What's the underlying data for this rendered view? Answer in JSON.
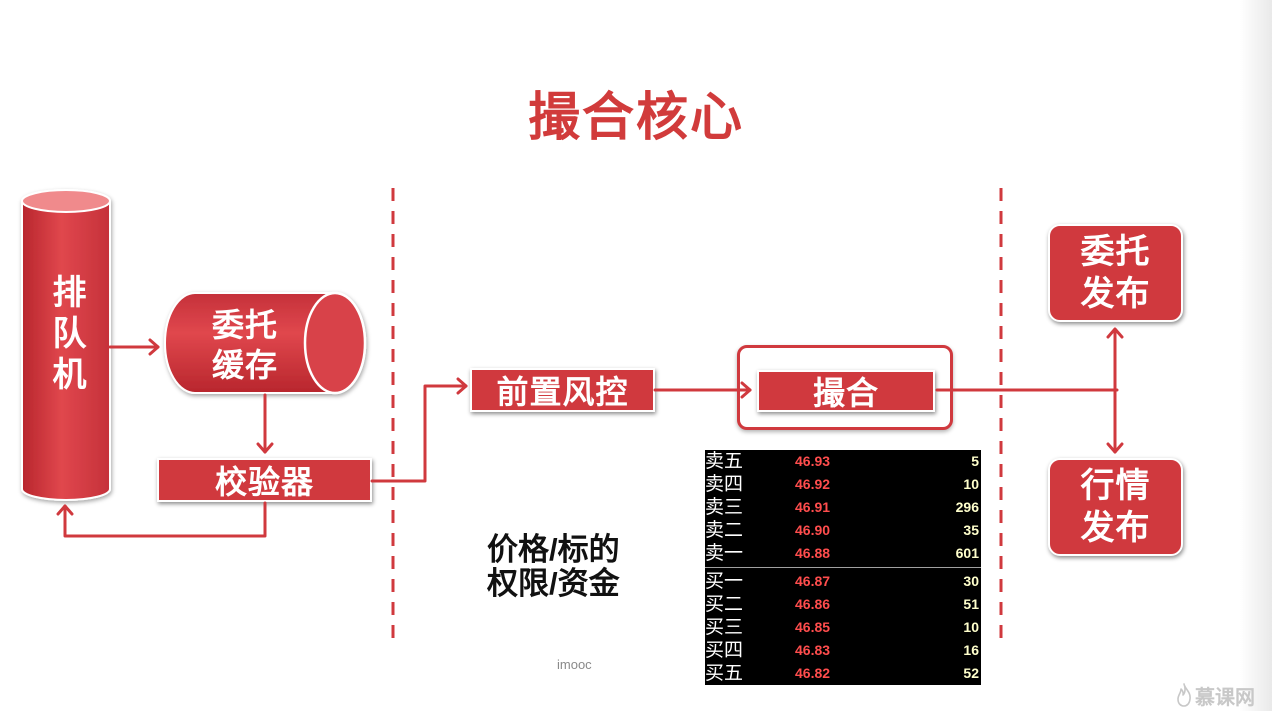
{
  "title": "撮合核心",
  "nodes": {
    "queue_machine": "排队机",
    "order_cache": [
      "委托",
      "缓存"
    ],
    "validator": "校验器",
    "pre_trade_risk": "前置风控",
    "matching": "撮合",
    "order_publish": [
      "委托",
      "发布"
    ],
    "market_data_publish": [
      "行情",
      "发布"
    ]
  },
  "risk_checks": [
    "价格/标的",
    "权限/资金"
  ],
  "order_book": {
    "asks": [
      {
        "level": "卖五",
        "price": "46.93",
        "volume": "5"
      },
      {
        "level": "卖四",
        "price": "46.92",
        "volume": "10"
      },
      {
        "level": "卖三",
        "price": "46.91",
        "volume": "296"
      },
      {
        "level": "卖二",
        "price": "46.90",
        "volume": "35"
      },
      {
        "level": "卖一",
        "price": "46.88",
        "volume": "601"
      }
    ],
    "bids": [
      {
        "level": "买一",
        "price": "46.87",
        "volume": "30"
      },
      {
        "level": "买二",
        "price": "46.86",
        "volume": "51"
      },
      {
        "level": "买三",
        "price": "46.85",
        "volume": "10"
      },
      {
        "level": "买四",
        "price": "46.83",
        "volume": "16"
      },
      {
        "level": "买五",
        "price": "46.82",
        "volume": "52"
      }
    ]
  },
  "footer": {
    "course_mark": "imooc",
    "watermark": "慕课网"
  },
  "icons": {
    "watermark_logo": "flame-logo-icon"
  },
  "colors": {
    "accent": "#d0393e",
    "title": "#d13b3b",
    "cylinder_top": "#f08a8c",
    "order_book_bg": "#000000",
    "order_book_level": "#ffffff",
    "order_book_price": "#ff4d4d",
    "order_book_volume": "#ffffcc"
  }
}
